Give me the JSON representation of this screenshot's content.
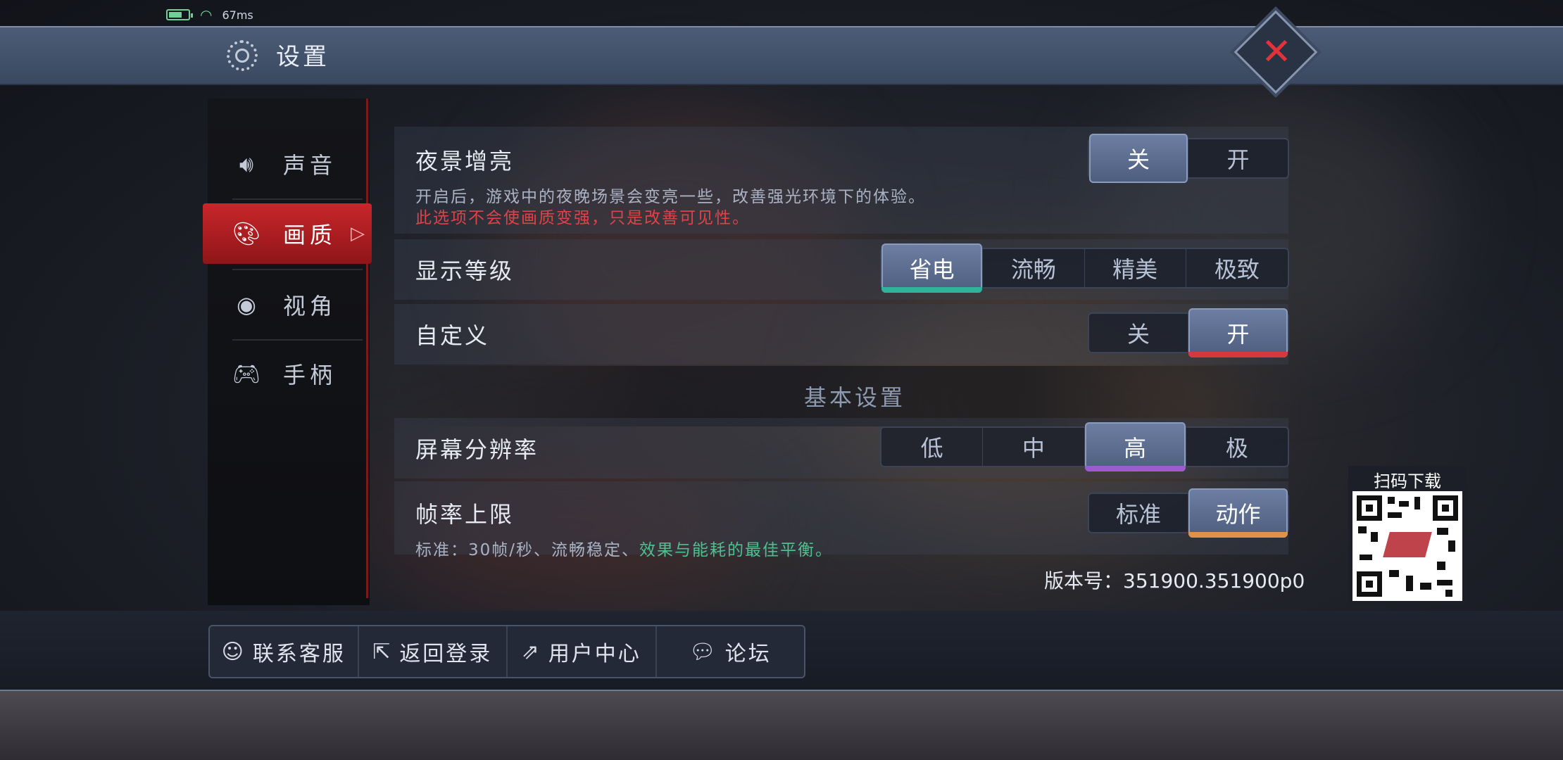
{
  "status": {
    "latency": "67ms",
    "battery_level": 0.6
  },
  "header": {
    "title": "设置",
    "icon": "gear-icon",
    "close_icon": "close-icon"
  },
  "sidebar": {
    "items": [
      {
        "label": "声音",
        "icon": "speaker-icon",
        "active": false
      },
      {
        "label": "画质",
        "icon": "paint-brush-icon",
        "active": true
      },
      {
        "label": "视角",
        "icon": "eye-icon",
        "active": false
      },
      {
        "label": "手柄",
        "icon": "gamepad-icon",
        "active": false
      }
    ]
  },
  "settings": {
    "night_boost": {
      "title": "夜景增亮",
      "desc": "开启后，游戏中的夜晚场景会变亮一些，改善强光环境下的体验。",
      "warning": "此选项不会使画质变强，只是改善可见性。",
      "options": [
        "关",
        "开"
      ],
      "selected": "关"
    },
    "display_level": {
      "title": "显示等级",
      "options": [
        "省电",
        "流畅",
        "精美",
        "极致"
      ],
      "selected": "省电"
    },
    "custom": {
      "title": "自定义",
      "options": [
        "关",
        "开"
      ],
      "selected": "开"
    },
    "section_basic": "基本设置",
    "resolution": {
      "title": "屏幕分辨率",
      "options": [
        "低",
        "中",
        "高",
        "极"
      ],
      "selected": "高"
    },
    "frame_limit": {
      "title": "帧率上限",
      "desc_prefix": "标准：30帧/秒、流畅稳定、",
      "desc_highlight": "效果与能耗的最佳平衡。",
      "options": [
        "标准",
        "动作"
      ],
      "selected": "动作"
    }
  },
  "version": "版本号：351900.351900p0",
  "qr": {
    "label": "扫码下载"
  },
  "footer": {
    "buttons": [
      {
        "label": "联系客服",
        "icon": "support-icon"
      },
      {
        "label": "返回登录",
        "icon": "logout-icon"
      },
      {
        "label": "用户中心",
        "icon": "user-center-icon"
      },
      {
        "label": "论坛",
        "icon": "forum-icon"
      }
    ]
  },
  "colors": {
    "accent_red": "#c8262b",
    "bar_teal": "#2fb39a",
    "bar_red": "#d23a3f",
    "bar_purple": "#9a5ccf",
    "bar_orange": "#e0924a",
    "highlight_green": "#4fc08d"
  }
}
